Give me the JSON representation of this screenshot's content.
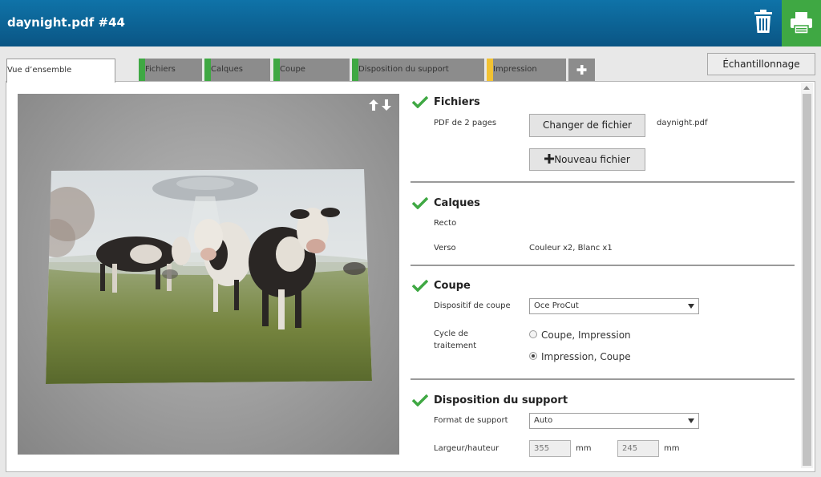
{
  "header": {
    "title": "daynight.pdf #44",
    "trash_icon": "trash-icon",
    "print_icon": "printer-icon",
    "print_color": "#3fa843"
  },
  "tabs": [
    {
      "label": "Vue d’ensemble",
      "active": true
    },
    {
      "label": "Fichiers",
      "marker": "#3fa843"
    },
    {
      "label": "Calques",
      "marker": "#3fa843"
    },
    {
      "label": "Coupe",
      "marker": "#3fa843"
    },
    {
      "label": "Disposition du support",
      "marker": "#3fa843"
    },
    {
      "label": "Impression",
      "marker": "#f2c232"
    }
  ],
  "add_tab_icon": "plus-icon",
  "sampling_button": "Échantillonnage",
  "preview": {
    "image": "cows-in-field",
    "arrows_icon": "up-down-arrows-icon"
  },
  "sections": {
    "fichiers": {
      "title": "Fichiers",
      "info": "PDF de 2 pages",
      "change_button": "Changer de fichier",
      "filename": "daynight.pdf",
      "new_button": "Nouveau fichier"
    },
    "calques": {
      "title": "Calques",
      "recto_label": "Recto",
      "verso_label": "Verso",
      "verso_value": "Couleur x2, Blanc x1"
    },
    "coupe": {
      "title": "Coupe",
      "device_label": "Dispositif de coupe",
      "device_value": "Oce ProCut",
      "cycle_label_1": "Cycle de",
      "cycle_label_2": "traitement",
      "option_1": "Coupe, Impression",
      "option_2": "Impression, Coupe",
      "selected": "Impression, Coupe"
    },
    "disposition": {
      "title": "Disposition du support",
      "format_label": "Format de support",
      "format_value": "Auto",
      "size_label": "Largeur/hauteur",
      "width": "355",
      "height": "245",
      "unit": "mm"
    }
  },
  "colors": {
    "header": "#0a5f94",
    "check": "#3fa843"
  }
}
